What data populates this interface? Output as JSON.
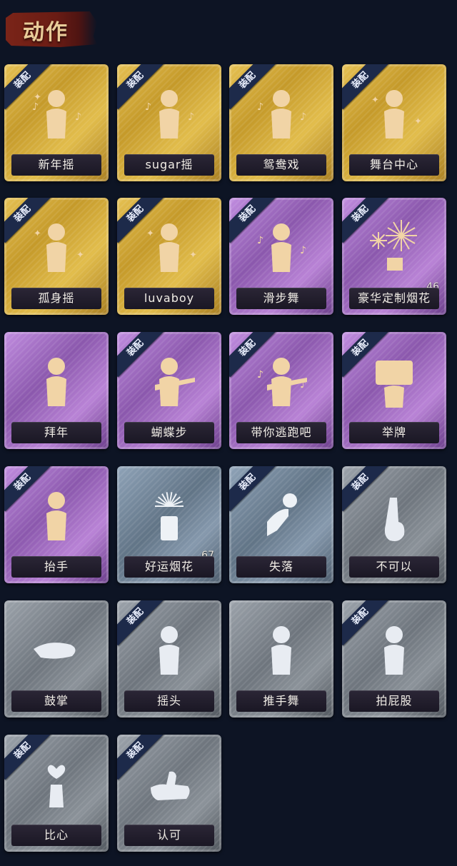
{
  "header": {
    "title": "动作"
  },
  "badge_text": "装配",
  "cards": [
    {
      "label": "新年摇",
      "rarity": "gold",
      "equip": true,
      "icon": "figure-clap-notes-icon"
    },
    {
      "label": "sugar摇",
      "rarity": "gold",
      "equip": true,
      "icon": "figure-notes-icon"
    },
    {
      "label": "鸳鸯戏",
      "rarity": "gold",
      "equip": true,
      "icon": "figure-notes-icon"
    },
    {
      "label": "舞台中心",
      "rarity": "gold",
      "equip": true,
      "icon": "figure-sparkle-icon"
    },
    {
      "label": "孤身摇",
      "rarity": "gold",
      "equip": true,
      "icon": "figure-sparkle-icon"
    },
    {
      "label": "luvaboy",
      "rarity": "gold",
      "equip": true,
      "icon": "figure-sparkle-icon"
    },
    {
      "label": "滑步舞",
      "rarity": "purple",
      "equip": true,
      "icon": "figure-notes-icon"
    },
    {
      "label": "豪华定制烟花",
      "rarity": "purple",
      "equip": true,
      "icon": "fireworks-icon",
      "count": "46"
    },
    {
      "label": "拜年",
      "rarity": "purple",
      "equip": false,
      "icon": "figure-bow-icon"
    },
    {
      "label": "蝴蝶步",
      "rarity": "purple",
      "equip": true,
      "icon": "figure-point-icon"
    },
    {
      "label": "带你逃跑吧",
      "rarity": "purple",
      "equip": true,
      "icon": "figure-point-notes-icon"
    },
    {
      "label": "举牌",
      "rarity": "purple",
      "equip": true,
      "icon": "figure-sign-icon"
    },
    {
      "label": "抬手",
      "rarity": "purple",
      "equip": true,
      "icon": "figure-raise-hand-icon"
    },
    {
      "label": "好运烟花",
      "rarity": "steel",
      "equip": false,
      "icon": "firework-can-icon",
      "count": "67"
    },
    {
      "label": "失落",
      "rarity": "steel",
      "equip": true,
      "icon": "figure-crawl-icon"
    },
    {
      "label": "不可以",
      "rarity": "gray",
      "equip": true,
      "icon": "finger-wag-icon"
    },
    {
      "label": "鼓掌",
      "rarity": "gray",
      "equip": false,
      "icon": "hands-clap-icon"
    },
    {
      "label": "摇头",
      "rarity": "gray",
      "equip": true,
      "icon": "figure-shake-icon"
    },
    {
      "label": "推手舞",
      "rarity": "gray",
      "equip": false,
      "icon": "figure-push-icon"
    },
    {
      "label": "拍屁股",
      "rarity": "gray",
      "equip": true,
      "icon": "figure-bend-icon"
    },
    {
      "label": "比心",
      "rarity": "gray",
      "equip": true,
      "icon": "heart-hand-icon"
    },
    {
      "label": "认可",
      "rarity": "gray",
      "equip": true,
      "icon": "thumbs-up-icon"
    }
  ]
}
